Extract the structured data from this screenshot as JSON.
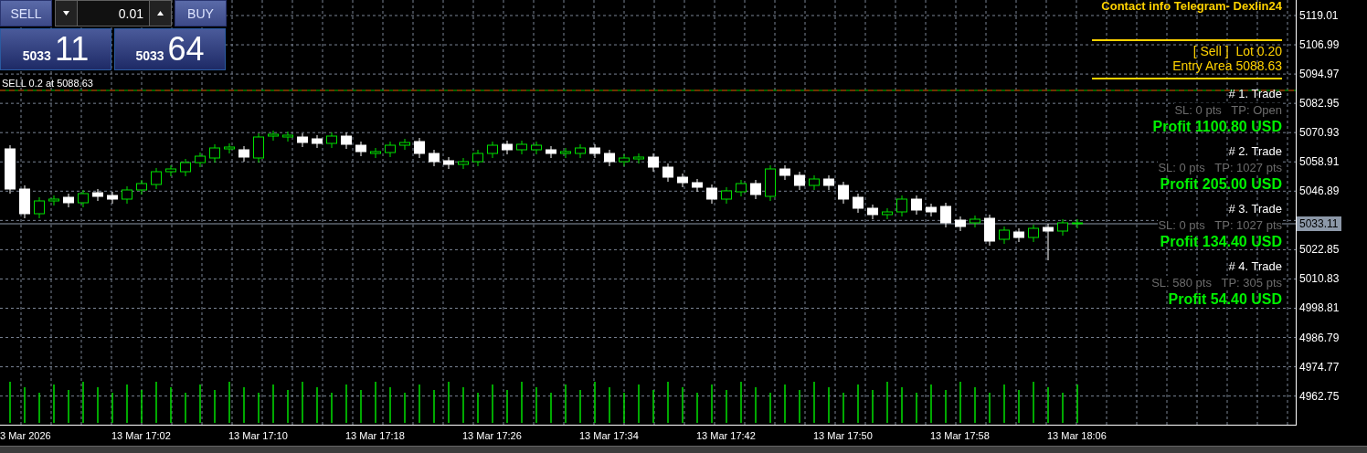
{
  "header": {
    "contact": "Contact info  Telegram- Dexlin24"
  },
  "one_click": {
    "sell_label": "SELL",
    "buy_label": "BUY",
    "lot": "0.01",
    "sell_price": {
      "main": "5033",
      "pips": "11"
    },
    "buy_price": {
      "main": "5033",
      "pips": "64"
    }
  },
  "order_line": {
    "label": "SELL 0.2 at 5088.63"
  },
  "summary": {
    "side_lot": "[ Sell ]  Lot 0.20",
    "entry": "Entry Area 5088.63"
  },
  "trades": [
    {
      "title": "# 1. Trade",
      "levels": "SL: 0 pts   TP: Open",
      "profit": "Profit 1100.80 USD"
    },
    {
      "title": "# 2. Trade",
      "levels": "SL: 0 pts   TP: 1027 pts",
      "profit": "Profit 205.00 USD"
    },
    {
      "title": "# 3. Trade",
      "levels": "SL: 0 pts   TP: 1027 pts",
      "profit": "Profit 134.40 USD"
    },
    {
      "title": "# 4. Trade",
      "levels": "SL: 580 pts   TP: 305 pts",
      "profit": "Profit 54.40 USD"
    }
  ],
  "price_axis": {
    "labels": [
      {
        "kind": "tick",
        "text": "5119.01"
      },
      {
        "kind": "tick",
        "text": "5106.99"
      },
      {
        "kind": "tick",
        "text": "5094.97"
      },
      {
        "kind": "tick",
        "text": "5082.95"
      },
      {
        "kind": "tick",
        "text": "5070.93"
      },
      {
        "kind": "tick",
        "text": "5058.91"
      },
      {
        "kind": "tick",
        "text": "5046.89"
      },
      {
        "kind": "current",
        "text": "5033.11"
      },
      {
        "kind": "tick",
        "text": "5022.85"
      },
      {
        "kind": "tick",
        "text": "5010.83"
      },
      {
        "kind": "tick",
        "text": "4998.81"
      },
      {
        "kind": "tick",
        "text": "4986.79"
      },
      {
        "kind": "tick",
        "text": "4974.77"
      },
      {
        "kind": "tick",
        "text": "4962.75"
      }
    ]
  },
  "time_axis": {
    "labels": [
      "3 Mar 2026",
      "13 Mar 17:02",
      "13 Mar 17:10",
      "13 Mar 17:18",
      "13 Mar 17:26",
      "13 Mar 17:34",
      "13 Mar 17:42",
      "13 Mar 17:50",
      "13 Mar 17:58",
      "13 Mar 18:06"
    ]
  }
}
